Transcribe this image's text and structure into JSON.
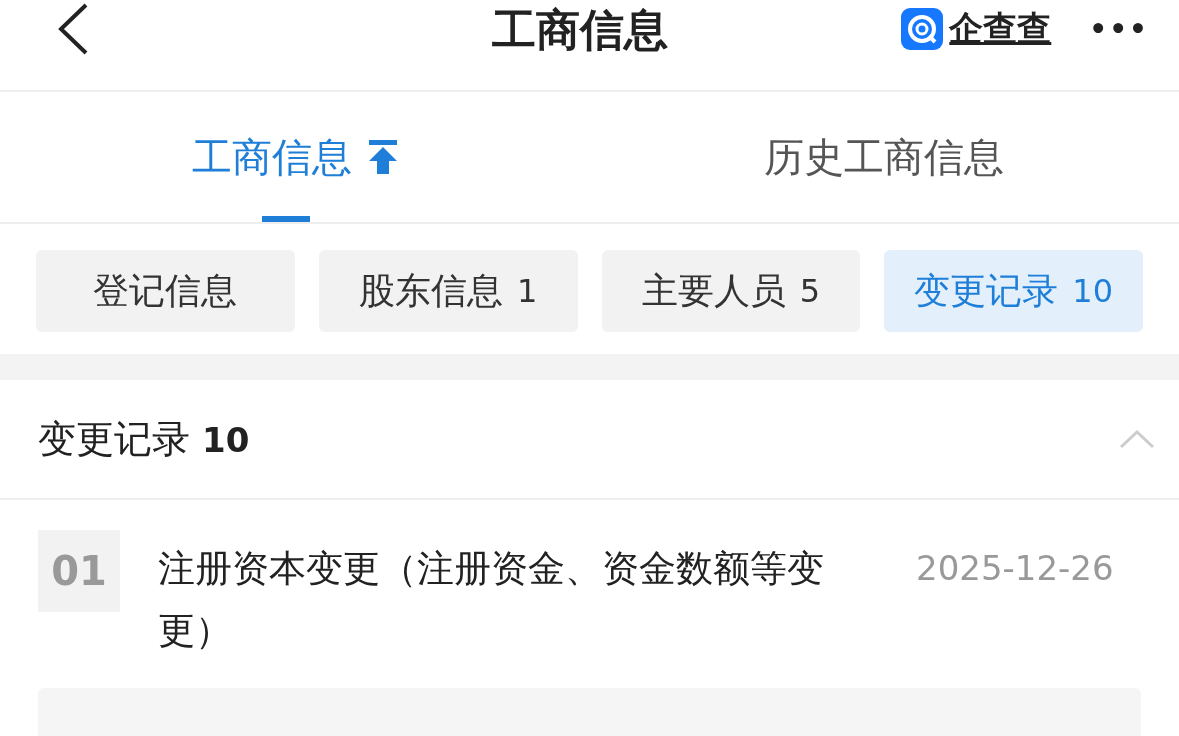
{
  "header": {
    "title": "工商信息",
    "brand": "企查查",
    "more": "•••"
  },
  "tabs": [
    {
      "label": "工商信息",
      "selected": true
    },
    {
      "label": "历史工商信息",
      "selected": false
    }
  ],
  "chips": [
    {
      "label": "登记信息",
      "selected": false
    },
    {
      "label": "股东信息",
      "count": "1",
      "selected": false
    },
    {
      "label": "主要人员",
      "count": "5",
      "selected": false
    },
    {
      "label": "变更记录",
      "count": "10",
      "selected": true
    }
  ],
  "section": {
    "title": "变更记录",
    "count": "10",
    "expanded": true
  },
  "records": [
    {
      "index": "01",
      "title": "注册资本变更（注册资金、资金数额等变更）",
      "date": "2025-12-26"
    }
  ]
}
